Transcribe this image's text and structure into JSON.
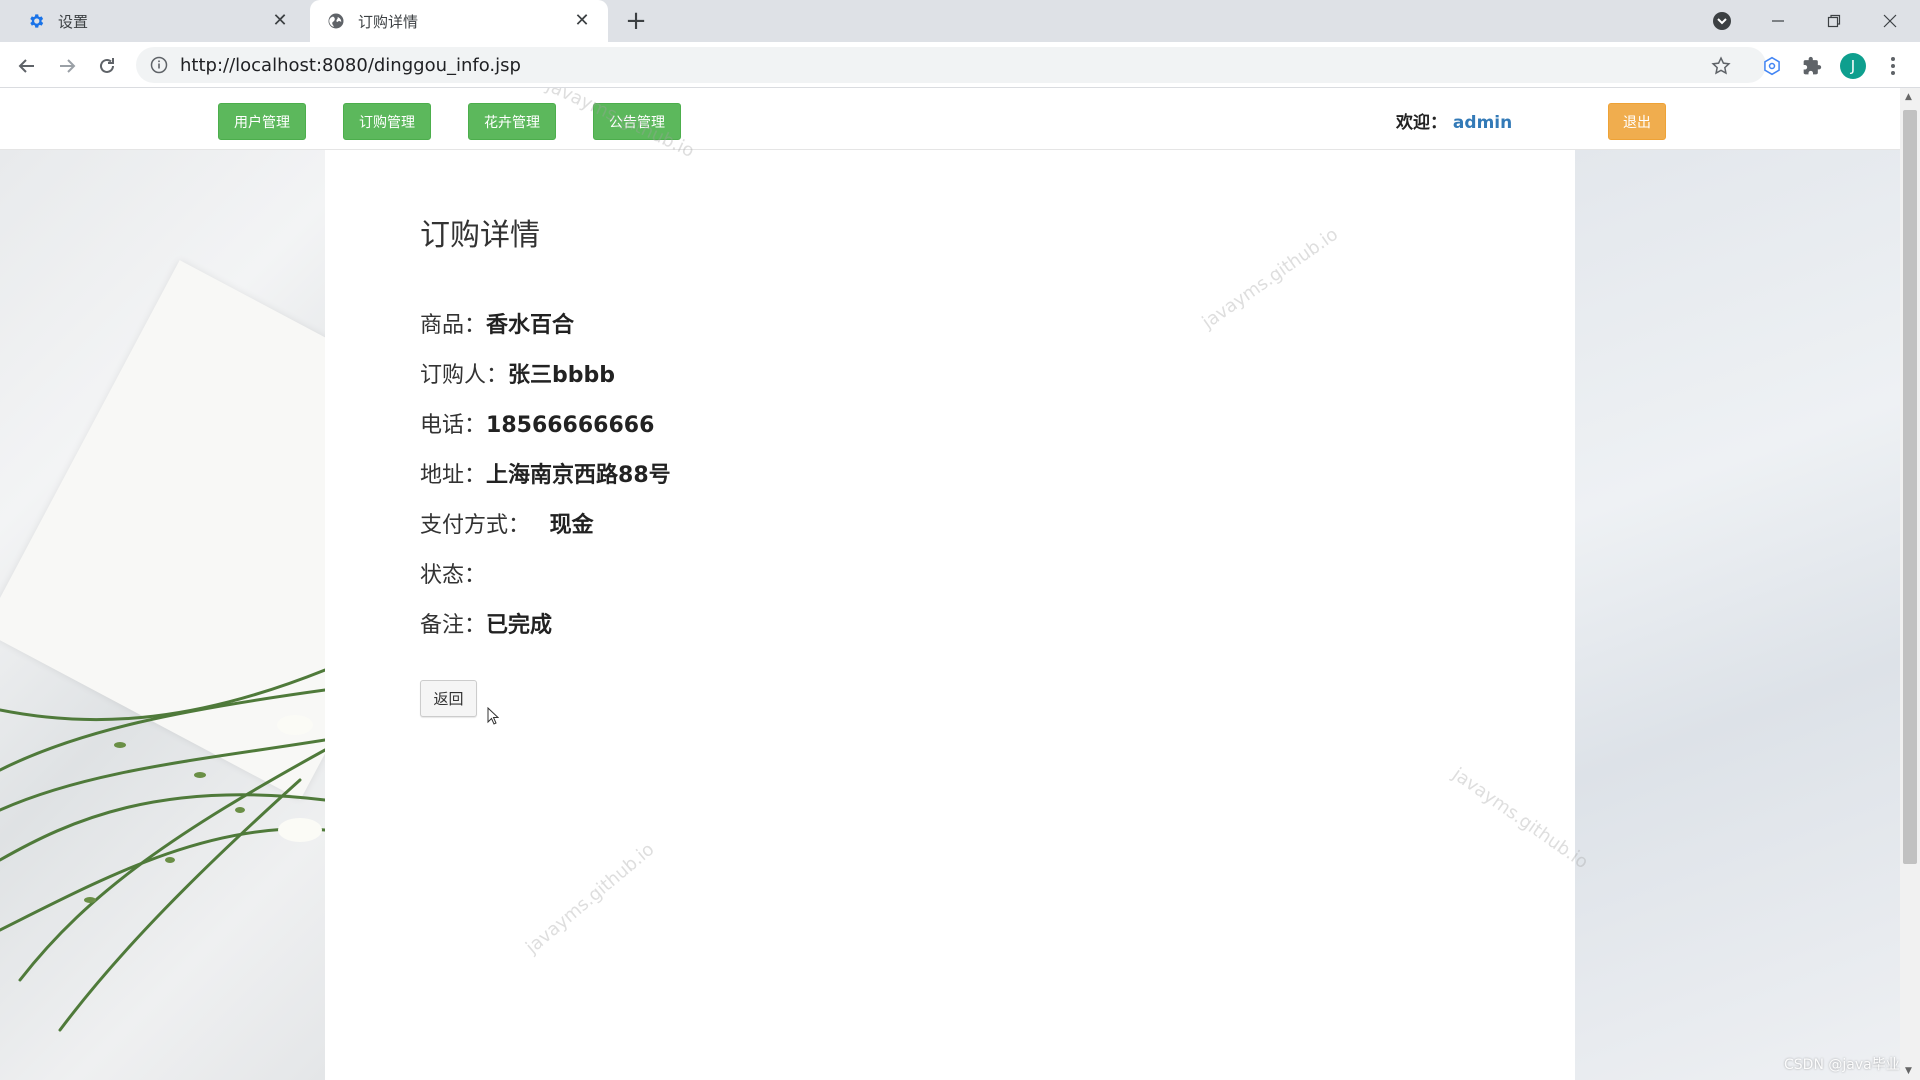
{
  "browser": {
    "tabs": [
      {
        "title": "设置",
        "icon": "gear-icon",
        "active": false
      },
      {
        "title": "订购详情",
        "icon": "globe-icon",
        "active": true
      }
    ],
    "url": "http://localhost:8080/dinggou_info.jsp",
    "profile_initial": "J"
  },
  "nav": {
    "buttons": [
      "用户管理",
      "订购管理",
      "花卉管理",
      "公告管理"
    ],
    "welcome_label": "欢迎：",
    "username": "admin",
    "logout_label": "退出"
  },
  "detail": {
    "title": "订购详情",
    "fields": [
      {
        "label": "商品：",
        "value": "香水百合"
      },
      {
        "label": "订购人：",
        "value": "张三bbbb"
      },
      {
        "label": "电话：",
        "value": "18566666666"
      },
      {
        "label": "地址：",
        "value": "上海南京西路88号"
      },
      {
        "label": "支付方式：",
        "value": " 现金"
      },
      {
        "label": "状态：",
        "value": ""
      },
      {
        "label": "备注：",
        "value": "已完成"
      }
    ],
    "back_label": "返回"
  },
  "watermark_text": "javayms.github.io",
  "credit": "CSDN @java毕业",
  "colors": {
    "nav_button_green": "#5cb85c",
    "logout_orange": "#f0ad4e",
    "username_blue": "#337ab7"
  }
}
